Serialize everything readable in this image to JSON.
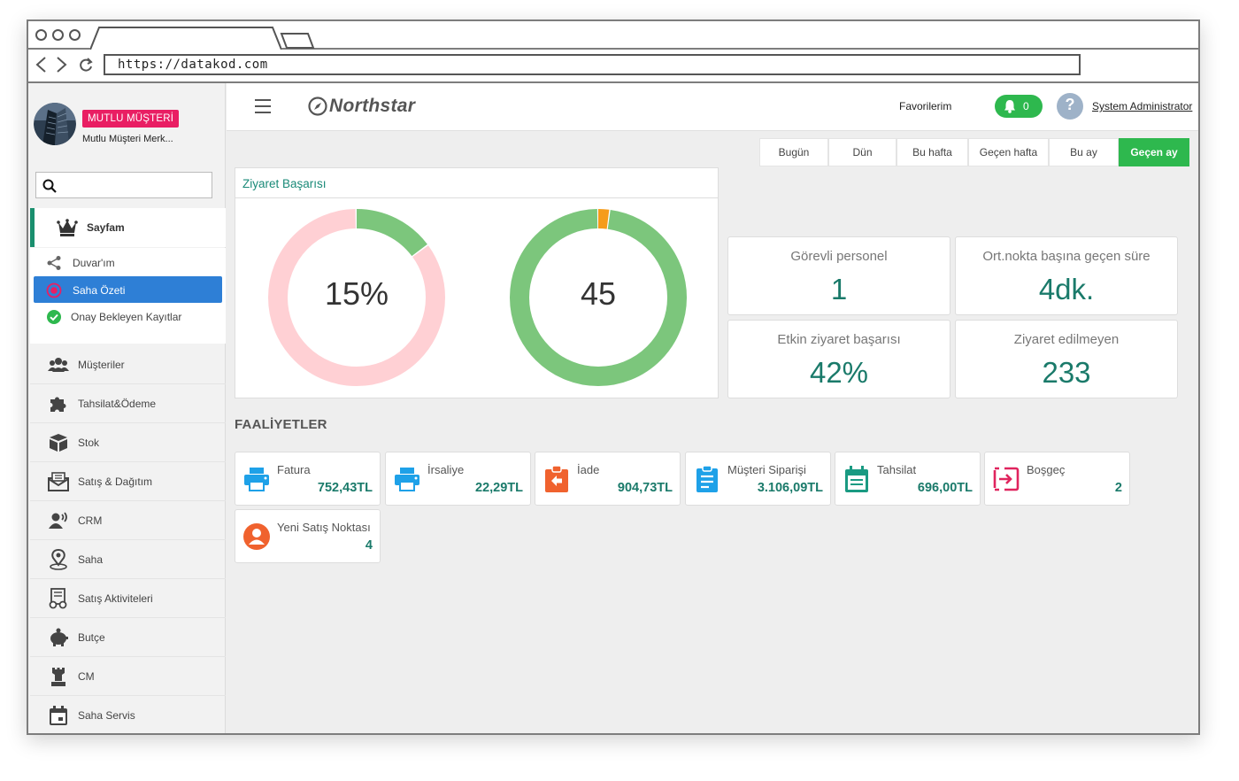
{
  "browser": {
    "url": "https://datakod.com"
  },
  "profile": {
    "badge": "MUTLU MÜŞTERİ",
    "subtitle": "Mutlu Müşteri Merk..."
  },
  "search": {
    "placeholder": ""
  },
  "sidebar": {
    "home": {
      "label": "Sayfam",
      "icon": "crown-icon"
    },
    "sub_items": [
      {
        "label": "Duvar'ım",
        "icon": "share-icon",
        "active": false
      },
      {
        "label": "Saha Özeti",
        "icon": "target-icon",
        "active": true
      },
      {
        "label": "Onay Bekleyen Kayıtlar",
        "icon": "check-circle-icon",
        "active": false
      }
    ],
    "items": [
      {
        "label": "Müşteriler",
        "icon": "users-icon"
      },
      {
        "label": "Tahsilat&Ödeme",
        "icon": "puzzle-icon"
      },
      {
        "label": "Stok",
        "icon": "box-icon"
      },
      {
        "label": "Satış & Dağıtım",
        "icon": "envelope-icon"
      },
      {
        "label": "CRM",
        "icon": "speaker-icon"
      },
      {
        "label": "Saha",
        "icon": "map-pin-icon"
      },
      {
        "label": "Satış Aktiviteleri",
        "icon": "receipt-icon"
      },
      {
        "label": "Butçe",
        "icon": "piggy-bank-icon"
      },
      {
        "label": "CM",
        "icon": "rook-icon"
      },
      {
        "label": "Saha Servis",
        "icon": "calendar-icon"
      }
    ]
  },
  "header": {
    "brand": "Northstar",
    "favorites": "Favorilerim",
    "notifications": "0",
    "user_initial": "?",
    "user": "System Administrator"
  },
  "date_tabs": [
    {
      "label": "Bugün",
      "active": false
    },
    {
      "label": "Dün",
      "active": false
    },
    {
      "label": "Bu hafta",
      "active": false
    },
    {
      "label": "Geçen hafta",
      "active": false
    },
    {
      "label": "Bu ay",
      "active": false
    },
    {
      "label": "Geçen ay",
      "active": true
    }
  ],
  "visit_panel": {
    "title": "Ziyaret Başarısı",
    "donut1": {
      "label": "15%",
      "fraction": 0.15,
      "fill_color": "#7cc67c",
      "track_color": "#ffd0d4"
    },
    "donut2": {
      "label": "45",
      "fraction": 0.022,
      "fill_color": "#f59c1a",
      "track_color": "#7cc67c"
    }
  },
  "stats": [
    {
      "label": "Görevli personel",
      "value": "1"
    },
    {
      "label": "Ort.nokta başına geçen süre",
      "value": "4dk."
    },
    {
      "label": "Etkin ziyaret başarısı",
      "value": "42%"
    },
    {
      "label": "Ziyaret edilmeyen",
      "value": "233"
    }
  ],
  "activities": {
    "title": "FAALİYETLER",
    "items": [
      {
        "label": "Fatura",
        "value": "752,43TL",
        "icon": "printer-icon",
        "color": "#1ea1e8"
      },
      {
        "label": "İrsaliye",
        "value": "22,29TL",
        "icon": "printer-icon",
        "color": "#1ea1e8"
      },
      {
        "label": "İade",
        "value": "904,73TL",
        "icon": "return-icon",
        "color": "#f0622e"
      },
      {
        "label": "Müşteri Siparişi",
        "value": "3.106,09TL",
        "icon": "clipboard-icon",
        "color": "#1ea1e8"
      },
      {
        "label": "Tahsilat",
        "value": "696,00TL",
        "icon": "calendar-check-icon",
        "color": "#1a9a82"
      },
      {
        "label": "Boşgeç",
        "value": "2",
        "icon": "exit-icon",
        "color": "#e0245e"
      },
      {
        "label": "Yeni Satış Noktası",
        "value": "4",
        "icon": "user-circle-icon",
        "color": "#f0622e"
      }
    ]
  },
  "colors": {
    "accent": "#2eb84e",
    "teal": "#1a7a6a",
    "active_blue": "#2e7fd6",
    "badge_pink": "#e91e63"
  }
}
